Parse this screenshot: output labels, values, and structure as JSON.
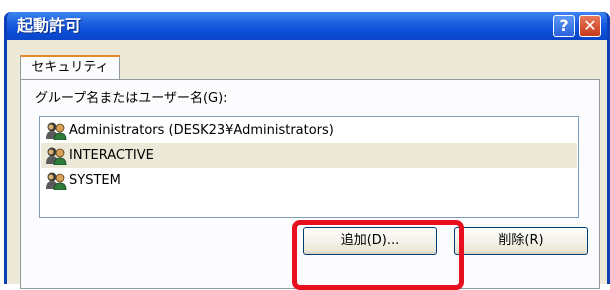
{
  "window": {
    "title": "起動許可"
  },
  "titlebar": {
    "help_glyph": "?",
    "close_glyph": "✕"
  },
  "tabs": [
    {
      "label": "セキュリティ",
      "active": true
    }
  ],
  "security": {
    "list_label": "グループ名またはユーザー名(G):",
    "entries": [
      {
        "name": "Administrators (DESK23¥Administrators)",
        "icon": "user-group-icon"
      },
      {
        "name": "INTERACTIVE",
        "icon": "user-group-icon",
        "selected": true
      },
      {
        "name": "SYSTEM",
        "icon": "user-group-icon"
      }
    ],
    "add_button": "追加(D)...",
    "remove_button": "削除(R)"
  },
  "colors": {
    "titlebar_blue": "#0c4ed8",
    "highlight_red": "#e8101f",
    "dialog_face": "#ece9d8"
  }
}
